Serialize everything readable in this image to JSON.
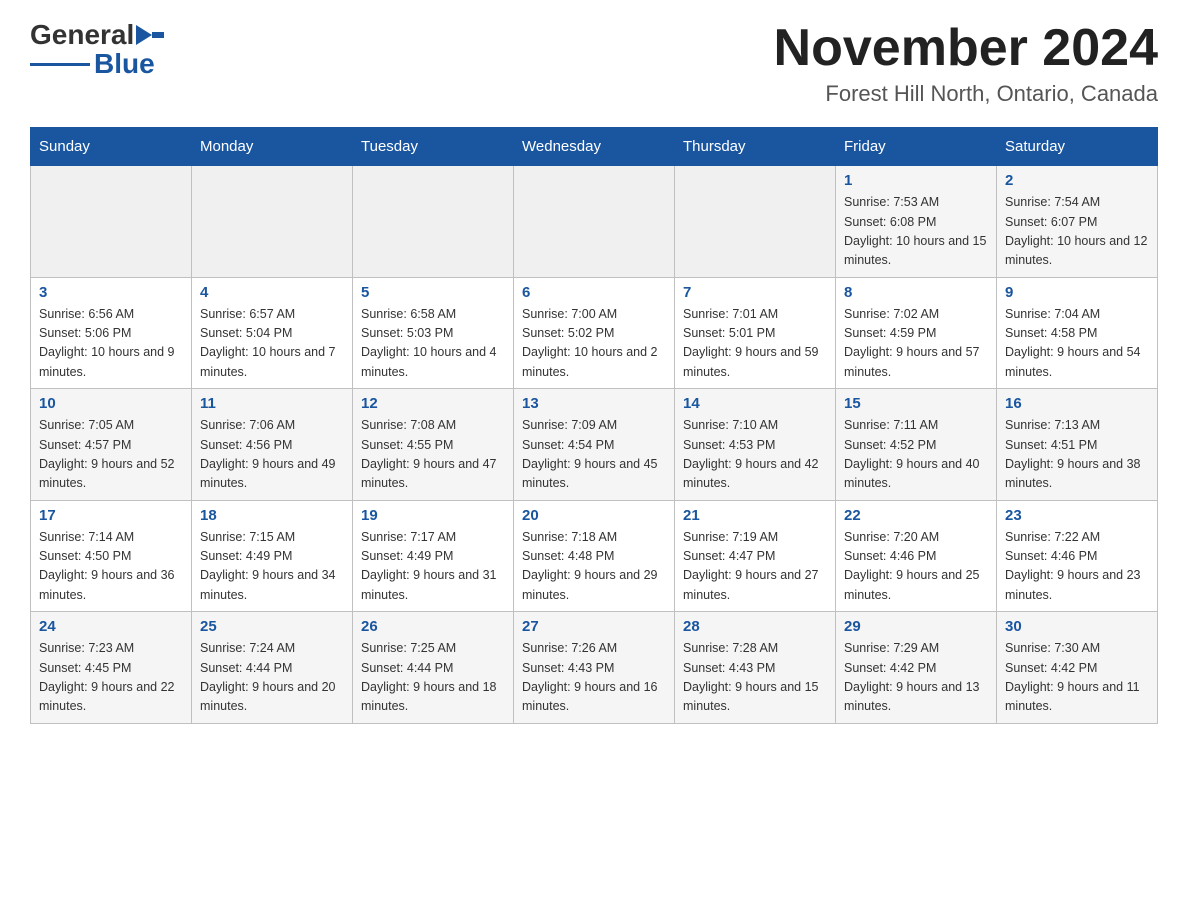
{
  "header": {
    "logo_general": "General",
    "logo_blue": "Blue",
    "main_title": "November 2024",
    "subtitle": "Forest Hill North, Ontario, Canada"
  },
  "weekdays": [
    "Sunday",
    "Monday",
    "Tuesday",
    "Wednesday",
    "Thursday",
    "Friday",
    "Saturday"
  ],
  "weeks": [
    [
      {
        "day": "",
        "sunrise": "",
        "sunset": "",
        "daylight": ""
      },
      {
        "day": "",
        "sunrise": "",
        "sunset": "",
        "daylight": ""
      },
      {
        "day": "",
        "sunrise": "",
        "sunset": "",
        "daylight": ""
      },
      {
        "day": "",
        "sunrise": "",
        "sunset": "",
        "daylight": ""
      },
      {
        "day": "",
        "sunrise": "",
        "sunset": "",
        "daylight": ""
      },
      {
        "day": "1",
        "sunrise": "Sunrise: 7:53 AM",
        "sunset": "Sunset: 6:08 PM",
        "daylight": "Daylight: 10 hours and 15 minutes."
      },
      {
        "day": "2",
        "sunrise": "Sunrise: 7:54 AM",
        "sunset": "Sunset: 6:07 PM",
        "daylight": "Daylight: 10 hours and 12 minutes."
      }
    ],
    [
      {
        "day": "3",
        "sunrise": "Sunrise: 6:56 AM",
        "sunset": "Sunset: 5:06 PM",
        "daylight": "Daylight: 10 hours and 9 minutes."
      },
      {
        "day": "4",
        "sunrise": "Sunrise: 6:57 AM",
        "sunset": "Sunset: 5:04 PM",
        "daylight": "Daylight: 10 hours and 7 minutes."
      },
      {
        "day": "5",
        "sunrise": "Sunrise: 6:58 AM",
        "sunset": "Sunset: 5:03 PM",
        "daylight": "Daylight: 10 hours and 4 minutes."
      },
      {
        "day": "6",
        "sunrise": "Sunrise: 7:00 AM",
        "sunset": "Sunset: 5:02 PM",
        "daylight": "Daylight: 10 hours and 2 minutes."
      },
      {
        "day": "7",
        "sunrise": "Sunrise: 7:01 AM",
        "sunset": "Sunset: 5:01 PM",
        "daylight": "Daylight: 9 hours and 59 minutes."
      },
      {
        "day": "8",
        "sunrise": "Sunrise: 7:02 AM",
        "sunset": "Sunset: 4:59 PM",
        "daylight": "Daylight: 9 hours and 57 minutes."
      },
      {
        "day": "9",
        "sunrise": "Sunrise: 7:04 AM",
        "sunset": "Sunset: 4:58 PM",
        "daylight": "Daylight: 9 hours and 54 minutes."
      }
    ],
    [
      {
        "day": "10",
        "sunrise": "Sunrise: 7:05 AM",
        "sunset": "Sunset: 4:57 PM",
        "daylight": "Daylight: 9 hours and 52 minutes."
      },
      {
        "day": "11",
        "sunrise": "Sunrise: 7:06 AM",
        "sunset": "Sunset: 4:56 PM",
        "daylight": "Daylight: 9 hours and 49 minutes."
      },
      {
        "day": "12",
        "sunrise": "Sunrise: 7:08 AM",
        "sunset": "Sunset: 4:55 PM",
        "daylight": "Daylight: 9 hours and 47 minutes."
      },
      {
        "day": "13",
        "sunrise": "Sunrise: 7:09 AM",
        "sunset": "Sunset: 4:54 PM",
        "daylight": "Daylight: 9 hours and 45 minutes."
      },
      {
        "day": "14",
        "sunrise": "Sunrise: 7:10 AM",
        "sunset": "Sunset: 4:53 PM",
        "daylight": "Daylight: 9 hours and 42 minutes."
      },
      {
        "day": "15",
        "sunrise": "Sunrise: 7:11 AM",
        "sunset": "Sunset: 4:52 PM",
        "daylight": "Daylight: 9 hours and 40 minutes."
      },
      {
        "day": "16",
        "sunrise": "Sunrise: 7:13 AM",
        "sunset": "Sunset: 4:51 PM",
        "daylight": "Daylight: 9 hours and 38 minutes."
      }
    ],
    [
      {
        "day": "17",
        "sunrise": "Sunrise: 7:14 AM",
        "sunset": "Sunset: 4:50 PM",
        "daylight": "Daylight: 9 hours and 36 minutes."
      },
      {
        "day": "18",
        "sunrise": "Sunrise: 7:15 AM",
        "sunset": "Sunset: 4:49 PM",
        "daylight": "Daylight: 9 hours and 34 minutes."
      },
      {
        "day": "19",
        "sunrise": "Sunrise: 7:17 AM",
        "sunset": "Sunset: 4:49 PM",
        "daylight": "Daylight: 9 hours and 31 minutes."
      },
      {
        "day": "20",
        "sunrise": "Sunrise: 7:18 AM",
        "sunset": "Sunset: 4:48 PM",
        "daylight": "Daylight: 9 hours and 29 minutes."
      },
      {
        "day": "21",
        "sunrise": "Sunrise: 7:19 AM",
        "sunset": "Sunset: 4:47 PM",
        "daylight": "Daylight: 9 hours and 27 minutes."
      },
      {
        "day": "22",
        "sunrise": "Sunrise: 7:20 AM",
        "sunset": "Sunset: 4:46 PM",
        "daylight": "Daylight: 9 hours and 25 minutes."
      },
      {
        "day": "23",
        "sunrise": "Sunrise: 7:22 AM",
        "sunset": "Sunset: 4:46 PM",
        "daylight": "Daylight: 9 hours and 23 minutes."
      }
    ],
    [
      {
        "day": "24",
        "sunrise": "Sunrise: 7:23 AM",
        "sunset": "Sunset: 4:45 PM",
        "daylight": "Daylight: 9 hours and 22 minutes."
      },
      {
        "day": "25",
        "sunrise": "Sunrise: 7:24 AM",
        "sunset": "Sunset: 4:44 PM",
        "daylight": "Daylight: 9 hours and 20 minutes."
      },
      {
        "day": "26",
        "sunrise": "Sunrise: 7:25 AM",
        "sunset": "Sunset: 4:44 PM",
        "daylight": "Daylight: 9 hours and 18 minutes."
      },
      {
        "day": "27",
        "sunrise": "Sunrise: 7:26 AM",
        "sunset": "Sunset: 4:43 PM",
        "daylight": "Daylight: 9 hours and 16 minutes."
      },
      {
        "day": "28",
        "sunrise": "Sunrise: 7:28 AM",
        "sunset": "Sunset: 4:43 PM",
        "daylight": "Daylight: 9 hours and 15 minutes."
      },
      {
        "day": "29",
        "sunrise": "Sunrise: 7:29 AM",
        "sunset": "Sunset: 4:42 PM",
        "daylight": "Daylight: 9 hours and 13 minutes."
      },
      {
        "day": "30",
        "sunrise": "Sunrise: 7:30 AM",
        "sunset": "Sunset: 4:42 PM",
        "daylight": "Daylight: 9 hours and 11 minutes."
      }
    ]
  ]
}
